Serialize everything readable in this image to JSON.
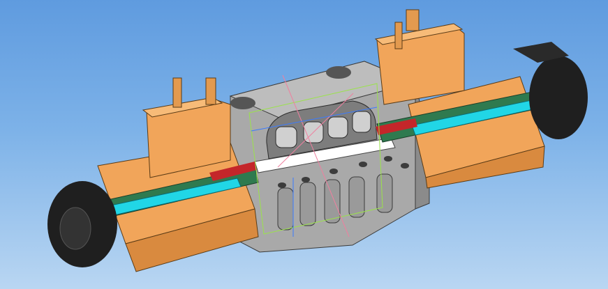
{
  "scene": {
    "description_visible_text": "",
    "background_top": "#5f9bdf",
    "background_bottom": "#b9d6f2",
    "colors": {
      "coil": "#f1a55a",
      "coil_dark": "#d98a3f",
      "body": "#a9a9a9",
      "body_dark": "#8b8b8b",
      "tube_green": "#2f7a4f",
      "core_cyan": "#21d6e6",
      "nut_black": "#1f1f1f",
      "accent_yellow": "#f2e22a",
      "seal_red": "#c4262a",
      "sketch_green": "#9ae34a",
      "sketch_pink": "#ef7f9f",
      "sketch_blue": "#3a7bff"
    }
  }
}
